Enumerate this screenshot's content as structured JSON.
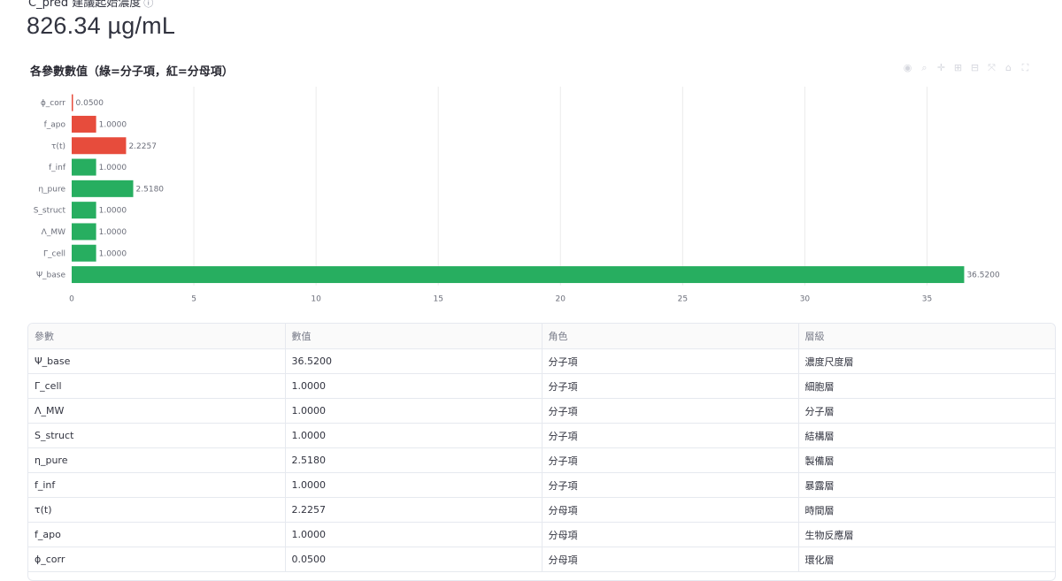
{
  "metric": {
    "label": "C_pred 建議起始濃度",
    "help_icon": "help-icon",
    "value": "826.34 µg/mL"
  },
  "chart_title": "各參數數值（綠=分子項，紅=分母項）",
  "colors": {
    "numerator": "#27ae60",
    "denominator": "#e74c3c",
    "grid": "#ebebeb",
    "axis_text": "#6b6e7a"
  },
  "modebar_icons": [
    "camera-icon",
    "zoom-icon",
    "pan-icon",
    "zoom-in-icon",
    "zoom-out-icon",
    "autoscale-icon",
    "home-icon",
    "fullscreen-icon"
  ],
  "chart_data": {
    "type": "bar",
    "orientation": "horizontal",
    "categories": [
      "ϕ_corr",
      "f_apo",
      "τ(t)",
      "f_inf",
      "η_pure",
      "S_struct",
      "Λ_MW",
      "Γ_cell",
      "Ψ_base"
    ],
    "values": [
      0.05,
      1.0,
      2.2257,
      1.0,
      2.518,
      1.0,
      1.0,
      1.0,
      36.52
    ],
    "value_labels": [
      "0.0500",
      "1.0000",
      "2.2257",
      "1.0000",
      "2.5180",
      "1.0000",
      "1.0000",
      "1.0000",
      "36.5200"
    ],
    "roles": [
      "denominator",
      "denominator",
      "denominator",
      "numerator",
      "numerator",
      "numerator",
      "numerator",
      "numerator",
      "numerator"
    ],
    "x_ticks": [
      0,
      5,
      10,
      15,
      20,
      25,
      30,
      35
    ],
    "xlim": [
      0,
      38.35
    ],
    "grid": true,
    "legend": "none"
  },
  "table": {
    "headers": [
      "參數",
      "數值",
      "角色",
      "層級"
    ],
    "rows": [
      [
        "Ψ_base",
        "36.5200",
        "分子項",
        "濃度尺度層"
      ],
      [
        "Γ_cell",
        "1.0000",
        "分子項",
        "細胞層"
      ],
      [
        "Λ_MW",
        "1.0000",
        "分子項",
        "分子層"
      ],
      [
        "S_struct",
        "1.0000",
        "分子項",
        "結構層"
      ],
      [
        "η_pure",
        "2.5180",
        "分子項",
        "製備層"
      ],
      [
        "f_inf",
        "1.0000",
        "分子項",
        "暴露層"
      ],
      [
        "τ(t)",
        "2.2257",
        "分母項",
        "時間層"
      ],
      [
        "f_apo",
        "1.0000",
        "分母項",
        "生物反應層"
      ],
      [
        "ϕ_corr",
        "0.0500",
        "分母項",
        "環化層"
      ]
    ]
  }
}
